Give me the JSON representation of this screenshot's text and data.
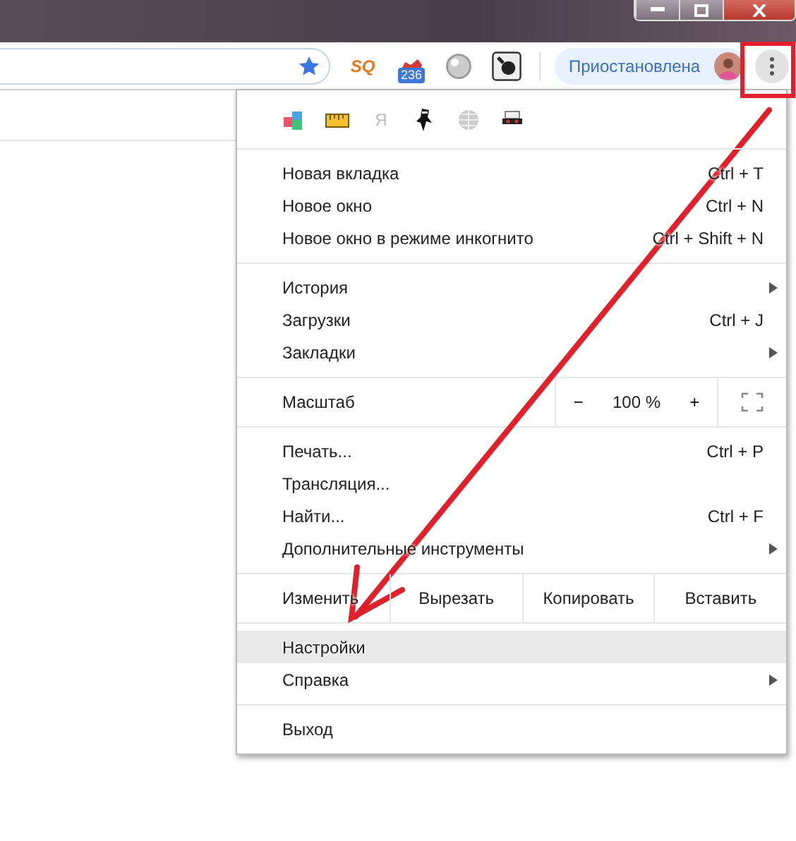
{
  "toolbar": {
    "extensions": [
      {
        "kind": "sq",
        "text": "SQ"
      },
      {
        "kind": "shoe",
        "badge": "236"
      },
      {
        "kind": "ball"
      },
      {
        "kind": "bomb"
      }
    ],
    "profile": {
      "label": "Приостановлена"
    }
  },
  "menu": {
    "extension_row": [
      {
        "kind": "cubes"
      },
      {
        "kind": "ruler"
      },
      {
        "kind": "letter",
        "text": "Я"
      },
      {
        "kind": "ninja"
      },
      {
        "kind": "globe"
      },
      {
        "kind": "mask"
      }
    ],
    "sections": [
      [
        {
          "kind": "item",
          "label": "Новая вкладка",
          "shortcut": "Ctrl + T",
          "submenu": false,
          "selected": false
        },
        {
          "kind": "item",
          "label": "Новое окно",
          "shortcut": "Ctrl + N",
          "submenu": false,
          "selected": false
        },
        {
          "kind": "item",
          "label": "Новое окно в режиме инкогнито",
          "shortcut": "Ctrl + Shift + N",
          "submenu": false,
          "selected": false
        }
      ],
      [
        {
          "kind": "item",
          "label": "История",
          "submenu": true,
          "selected": false
        },
        {
          "kind": "item",
          "label": "Загрузки",
          "shortcut": "Ctrl + J",
          "submenu": false,
          "selected": false
        },
        {
          "kind": "item",
          "label": "Закладки",
          "submenu": true,
          "selected": false
        }
      ],
      [
        {
          "kind": "zoom",
          "label": "Масштаб",
          "zoom_out": "−",
          "value": "100 %",
          "zoom_in": "+"
        }
      ],
      [
        {
          "kind": "item",
          "label": "Печать...",
          "shortcut": "Ctrl + P",
          "submenu": false,
          "selected": false
        },
        {
          "kind": "item",
          "label": "Трансляция...",
          "submenu": false,
          "selected": false
        },
        {
          "kind": "item",
          "label": "Найти...",
          "shortcut": "Ctrl + F",
          "submenu": false,
          "selected": false
        },
        {
          "kind": "item",
          "label": "Дополнительные инструменты",
          "submenu": true,
          "selected": false
        }
      ],
      [
        {
          "kind": "edit",
          "label": "Изменить",
          "buttons": [
            "Вырезать",
            "Копировать",
            "Вставить"
          ]
        }
      ],
      [
        {
          "kind": "item",
          "label": "Настройки",
          "submenu": false,
          "selected": true
        },
        {
          "kind": "item",
          "label": "Справка",
          "submenu": true,
          "selected": false
        }
      ],
      [
        {
          "kind": "item",
          "label": "Выход",
          "submenu": false,
          "selected": false
        }
      ]
    ]
  }
}
